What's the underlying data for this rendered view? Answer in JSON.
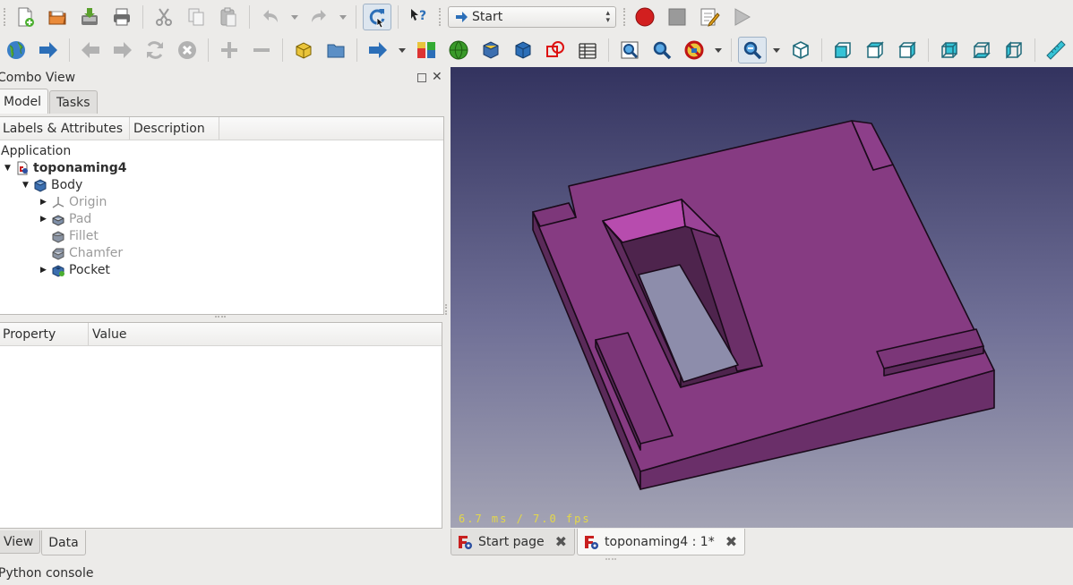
{
  "toolbar1": {
    "workbench_selector": "Start",
    "items": [
      "new-document",
      "open-document",
      "save-document",
      "print-document",
      "cut",
      "copy",
      "paste",
      "undo",
      "redo",
      "refresh",
      "whats-this",
      "workbench-selector",
      "record-macro",
      "stop-macro",
      "edit-macro",
      "execute-macro"
    ]
  },
  "toolbar2": {
    "items": [
      "web-home",
      "web-go",
      "back",
      "forward",
      "reload",
      "stop",
      "zoom-in-web",
      "zoom-out-web",
      "part",
      "group",
      "link-actions",
      "compound",
      "sphere",
      "box-shape",
      "cube",
      "draw-style",
      "spreadsheet",
      "view-fit-all",
      "view-fit-selection",
      "draw-style-toggle",
      "std-view-zoom",
      "axonometric",
      "front",
      "top",
      "right",
      "rear",
      "bottom",
      "left",
      "measure"
    ]
  },
  "combo": {
    "title": "Combo View",
    "tabs": [
      {
        "label": "Model",
        "active": true
      },
      {
        "label": "Tasks",
        "active": false
      }
    ],
    "tree_headers": [
      "Labels & Attributes",
      "Description"
    ],
    "tree": [
      {
        "label": "Application",
        "level": 0,
        "expander": "",
        "icon": "",
        "style": "normal"
      },
      {
        "label": "toponaming4",
        "level": 1,
        "expander": "open",
        "icon": "document-icon",
        "style": "bold"
      },
      {
        "label": "Body",
        "level": 2,
        "expander": "open",
        "icon": "body-icon",
        "style": "normal"
      },
      {
        "label": "Origin",
        "level": 3,
        "expander": "closed",
        "icon": "origin-icon",
        "style": "dim"
      },
      {
        "label": "Pad",
        "level": 3,
        "expander": "closed",
        "icon": "pad-icon",
        "style": "dim"
      },
      {
        "label": "Fillet",
        "level": 3,
        "expander": "",
        "icon": "fillet-icon",
        "style": "dim"
      },
      {
        "label": "Chamfer",
        "level": 3,
        "expander": "",
        "icon": "chamfer-icon",
        "style": "dim"
      },
      {
        "label": "Pocket",
        "level": 3,
        "expander": "closed",
        "icon": "pocket-icon",
        "style": "normal"
      }
    ],
    "property_headers": [
      "Property",
      "Value"
    ],
    "prop_tabs": [
      {
        "label": "View",
        "active": false
      },
      {
        "label": "Data",
        "active": true
      }
    ]
  },
  "view3d": {
    "fps": "6.7 ms / 7.0 fps",
    "model_color": "#7f3a7a"
  },
  "doc_tabs": [
    {
      "label": "Start page",
      "active": false
    },
    {
      "label": "toponaming4 : 1*",
      "active": true
    }
  ],
  "python_console": "Python console"
}
